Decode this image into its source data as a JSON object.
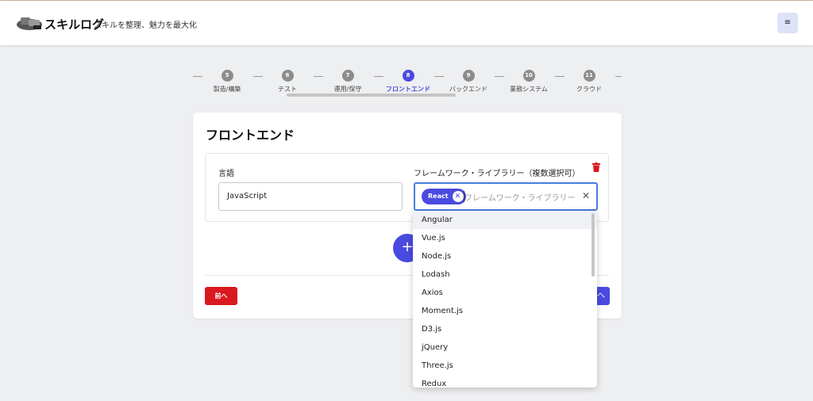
{
  "header": {
    "brand": "スキルログ",
    "tagline": "スキルを整理、魅力を最大化",
    "menu_icon": "≡"
  },
  "stepper": {
    "steps": [
      {
        "num": "5",
        "label": "製造/構築"
      },
      {
        "num": "6",
        "label": "テスト"
      },
      {
        "num": "7",
        "label": "運用/保守"
      },
      {
        "num": "8",
        "label": "フロントエンド"
      },
      {
        "num": "9",
        "label": "バックエンド"
      },
      {
        "num": "10",
        "label": "業務システム"
      },
      {
        "num": "11",
        "label": "クラウド"
      }
    ],
    "active_step": "8"
  },
  "card": {
    "title": "フロントエンド",
    "language_label": "言語",
    "language_value": "JavaScript",
    "framework_label": "フレームワーク・ライブラリー（複数選択可）",
    "framework_placeholder": "フレームワーク・ライブラリー",
    "selected_chip": "React",
    "add_button": "+",
    "prev_button": "前へ",
    "next_button": "へ"
  },
  "dropdown": {
    "options": [
      "Angular",
      "Vue.js",
      "Node.js",
      "Lodash",
      "Axios",
      "Moment.js",
      "D3.js",
      "jQuery",
      "Three.js",
      "Redux"
    ],
    "highlighted": "Angular"
  },
  "colors": {
    "accent": "#4a4ae0",
    "danger": "#d9191f",
    "background": "#eeeff1"
  }
}
